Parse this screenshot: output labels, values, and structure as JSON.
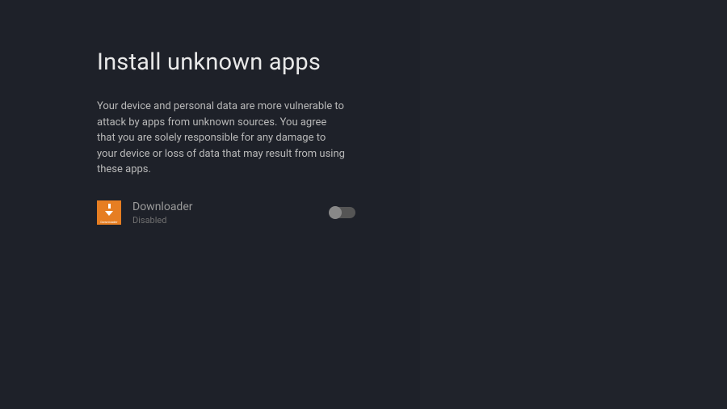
{
  "page": {
    "title": "Install unknown apps",
    "description": "Your device and personal data are more vulnerable to attack by apps from unknown sources. You agree that you are solely responsible for any damage to your device or loss of data that may result from using these apps."
  },
  "apps": [
    {
      "name": "Downloader",
      "status": "Disabled",
      "icon_label": "Downloader",
      "toggle_on": false
    }
  ]
}
